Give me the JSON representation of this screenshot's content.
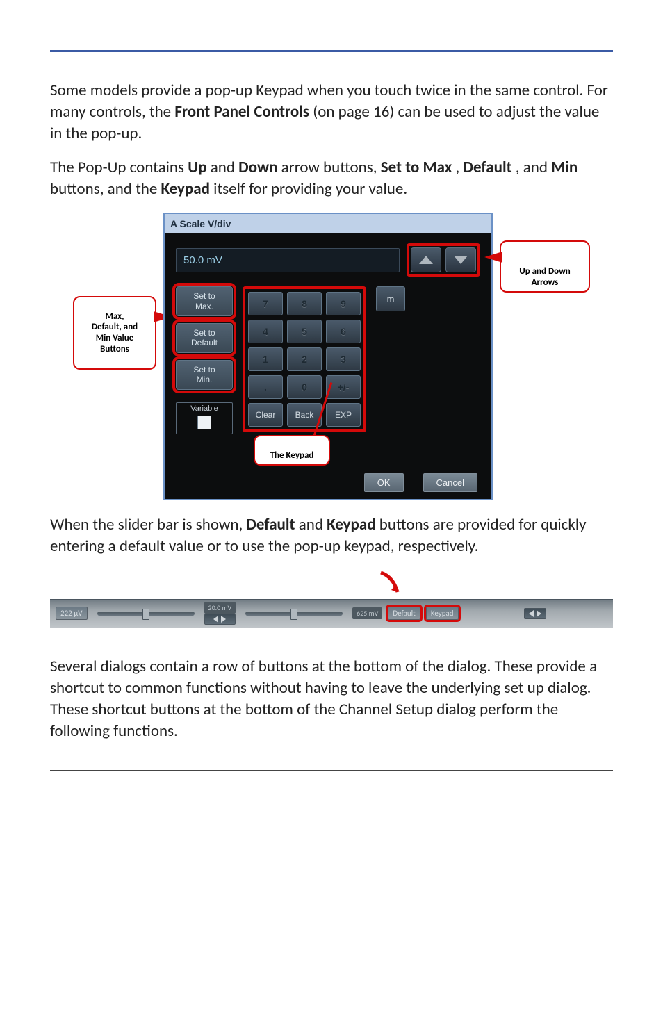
{
  "para1_a": "Some models provide a pop-up Keypad when you touch twice in the same control. For many controls, the ",
  "para1_b": "Front Panel Controls",
  "para1_c": " (on page 16) can be used to adjust the value in the pop-up.",
  "para2_a": "The Pop-Up contains ",
  "para2_up": "Up",
  "para2_and1": " and ",
  "para2_down": "Down",
  "para2_b": " arrow buttons, ",
  "para2_setmax": "Set to Max",
  "para2_c": ", ",
  "para2_default": "Default",
  "para2_d": ", and ",
  "para2_min": "Min",
  "para2_e": " buttons, and the ",
  "para2_keypad": "Keypad",
  "para2_f": " itself for providing your value.",
  "dialog": {
    "title": "A Scale V/div",
    "display": "50.0 mV",
    "set_max": "Set to\nMax.",
    "set_default": "Set to\nDefault",
    "set_min": "Set to\nMin.",
    "variable": "Variable",
    "keys": {
      "7": "7",
      "8": "8",
      "9": "9",
      "4": "4",
      "5": "5",
      "6": "6",
      "1": "1",
      "2": "2",
      "3": "3",
      "dot": ".",
      "0": "0",
      "pm": "+/-",
      "clear": "Clear",
      "back": "Back",
      "exp": "EXP"
    },
    "unit": "m",
    "ok": "OK",
    "cancel": "Cancel"
  },
  "callouts": {
    "left": "Max,\nDefault, and\nMin Value\nButtons",
    "right": "Up and Down\nArrows",
    "keypad": "The Keypad"
  },
  "para3_a": "When the slider bar is shown, ",
  "para3_def": "Default",
  "para3_b": " and ",
  "para3_kp": "Keypad",
  "para3_c": " buttons are provided for quickly entering a default value or to use the pop-up keypad, respectively.",
  "slider": {
    "left_chip": "222 µV",
    "mid_top": "20.0 mV",
    "readout": "625 mV",
    "default": "Default",
    "keypad": "Keypad"
  },
  "para4": "Several dialogs contain a row of buttons at the bottom of the dialog. These provide a shortcut to common functions without having to leave the underlying set up dialog. These shortcut buttons at the bottom of the Channel Setup dialog perform the following functions."
}
